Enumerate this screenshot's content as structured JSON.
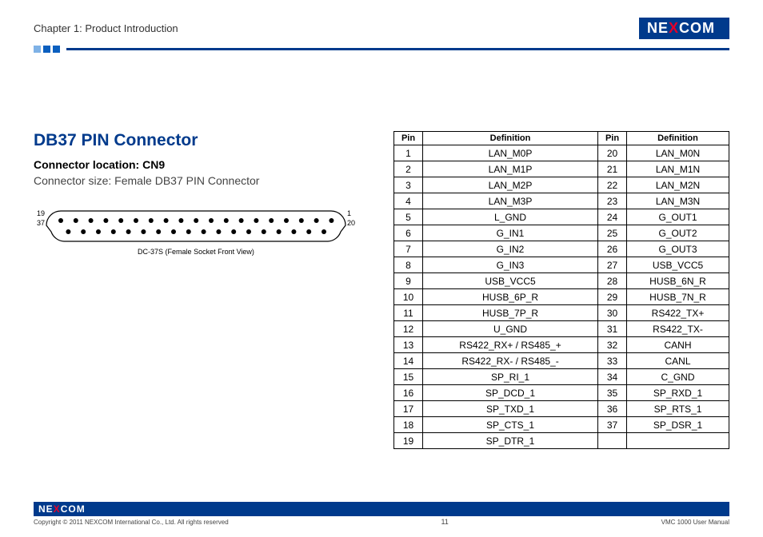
{
  "header": {
    "chapter_title": "Chapter 1: Product Introduction",
    "logo_pre": "NE",
    "logo_x": "X",
    "logo_post": "COM"
  },
  "main": {
    "heading": "DB37 PIN Connector",
    "subheading": "Connector location: CN9",
    "connector_size": "Connector size: Female DB37 PIN Connector",
    "diagram": {
      "label_top_left": "19",
      "label_bottom_left": "37",
      "label_top_right": "1",
      "label_bottom_right": "20",
      "caption": "DC-37S (Female Socket Front View)"
    }
  },
  "table": {
    "headers": {
      "pin": "Pin",
      "def": "Definition"
    },
    "rows": [
      {
        "p1": "1",
        "d1": "LAN_M0P",
        "p2": "20",
        "d2": "LAN_M0N"
      },
      {
        "p1": "2",
        "d1": "LAN_M1P",
        "p2": "21",
        "d2": "LAN_M1N"
      },
      {
        "p1": "3",
        "d1": "LAN_M2P",
        "p2": "22",
        "d2": "LAN_M2N"
      },
      {
        "p1": "4",
        "d1": "LAN_M3P",
        "p2": "23",
        "d2": "LAN_M3N"
      },
      {
        "p1": "5",
        "d1": "L_GND",
        "p2": "24",
        "d2": "G_OUT1"
      },
      {
        "p1": "6",
        "d1": "G_IN1",
        "p2": "25",
        "d2": "G_OUT2"
      },
      {
        "p1": "7",
        "d1": "G_IN2",
        "p2": "26",
        "d2": "G_OUT3"
      },
      {
        "p1": "8",
        "d1": "G_IN3",
        "p2": "27",
        "d2": "USB_VCC5"
      },
      {
        "p1": "9",
        "d1": "USB_VCC5",
        "p2": "28",
        "d2": "HUSB_6N_R"
      },
      {
        "p1": "10",
        "d1": "HUSB_6P_R",
        "p2": "29",
        "d2": "HUSB_7N_R"
      },
      {
        "p1": "11",
        "d1": "HUSB_7P_R",
        "p2": "30",
        "d2": "RS422_TX+"
      },
      {
        "p1": "12",
        "d1": "U_GND",
        "p2": "31",
        "d2": "RS422_TX-"
      },
      {
        "p1": "13",
        "d1": "RS422_RX+ / RS485_+",
        "p2": "32",
        "d2": "CANH"
      },
      {
        "p1": "14",
        "d1": "RS422_RX- / RS485_-",
        "p2": "33",
        "d2": "CANL"
      },
      {
        "p1": "15",
        "d1": "SP_RI_1",
        "p2": "34",
        "d2": "C_GND"
      },
      {
        "p1": "16",
        "d1": "SP_DCD_1",
        "p2": "35",
        "d2": "SP_RXD_1"
      },
      {
        "p1": "17",
        "d1": "SP_TXD_1",
        "p2": "36",
        "d2": "SP_RTS_1"
      },
      {
        "p1": "18",
        "d1": "SP_CTS_1",
        "p2": "37",
        "d2": "SP_DSR_1"
      },
      {
        "p1": "19",
        "d1": "SP_DTR_1",
        "p2": "",
        "d2": ""
      }
    ]
  },
  "footer": {
    "logo_pre": "NE",
    "logo_x": "X",
    "logo_post": "COM",
    "copyright": "Copyright © 2011 NEXCOM International Co., Ltd. All rights reserved",
    "page_number": "11",
    "manual": "VMC 1000 User Manual"
  }
}
